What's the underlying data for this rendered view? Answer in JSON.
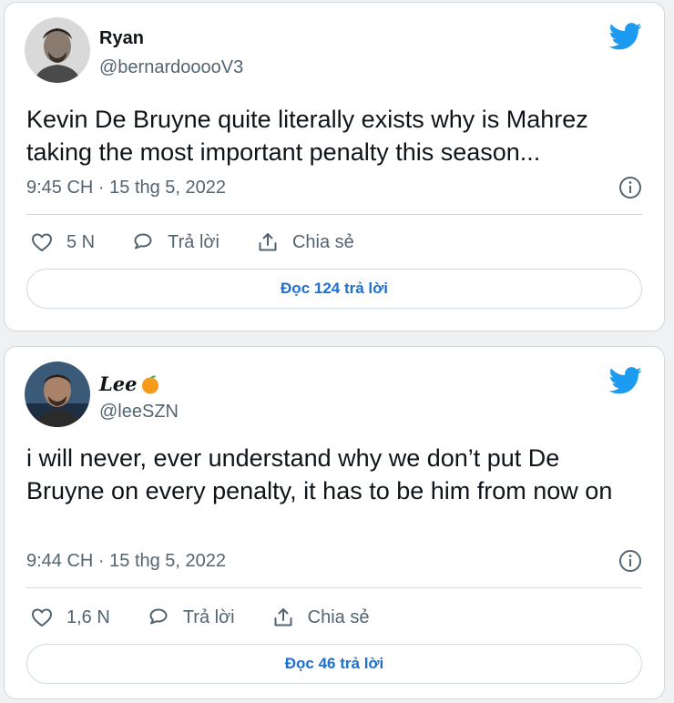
{
  "colors": {
    "twitter_blue": "#1d9bf0",
    "link_blue": "#1d6fd1",
    "text_primary": "#0f1419",
    "text_secondary": "#536471",
    "border": "#cfd9de"
  },
  "tweets": [
    {
      "name": "Ryan",
      "handle": "@bernardooooV3",
      "text": "Kevin De Bruyne quite literally exists why is Mahrez taking the most important penalty this season...",
      "timestamp": "9:45 CH · 15 thg 5, 2022",
      "likes": "5 N",
      "reply_label": "Trả lời",
      "share_label": "Chia sẻ",
      "read_replies": "Đọc 124 trả lời",
      "icons": [
        "twitter-bird-icon",
        "info-icon",
        "heart-icon",
        "reply-icon",
        "share-icon"
      ]
    },
    {
      "name": "Lee",
      "name_emoji": "orange-emoji-icon",
      "handle": "@leeSZN",
      "text": "i will never, ever understand why we don’t put De Bruyne on every penalty, it has to be him from now on",
      "timestamp": "9:44 CH · 15 thg 5, 2022",
      "likes": "1,6 N",
      "reply_label": "Trả lời",
      "share_label": "Chia sẻ",
      "read_replies": "Đọc 46 trả lời",
      "icons": [
        "twitter-bird-icon",
        "info-icon",
        "heart-icon",
        "reply-icon",
        "share-icon"
      ]
    }
  ]
}
